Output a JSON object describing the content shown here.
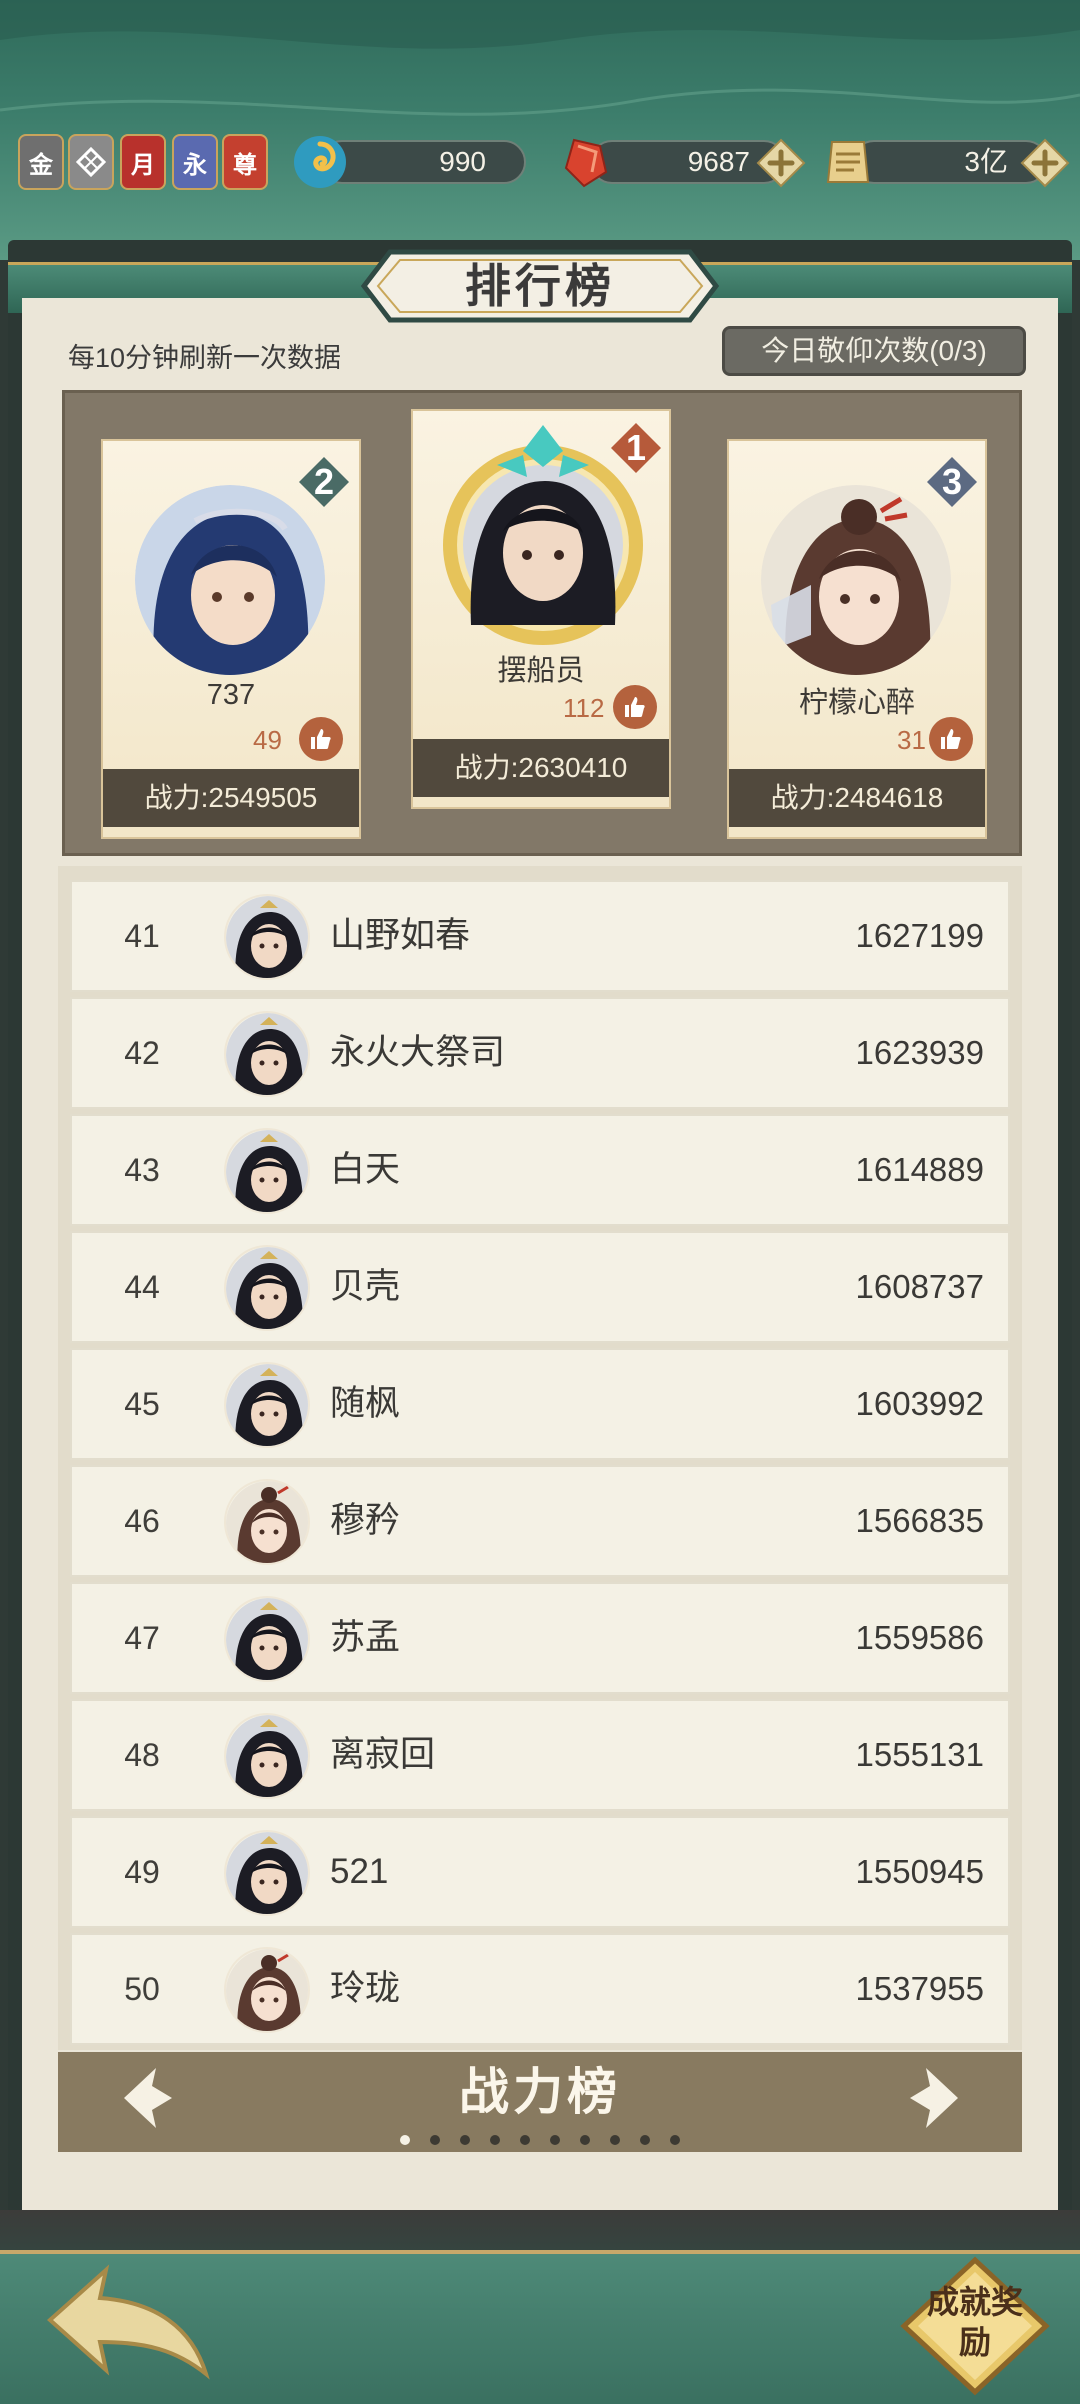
{
  "resources": {
    "badges": [
      {
        "label": "金",
        "color": "#6f6f6f",
        "icon": "gold-badge-icon"
      },
      {
        "label": "",
        "color": "#8a8a8a",
        "icon": "jade-knot-badge-icon"
      },
      {
        "label": "月",
        "color": "#b8312c",
        "icon": "month-card-badge-icon"
      },
      {
        "label": "永",
        "color": "#5a6ab0",
        "icon": "permanent-card-badge-icon"
      },
      {
        "label": "尊",
        "color": "#c4402f",
        "icon": "noble-badge-icon"
      }
    ],
    "stamina": {
      "value": "990",
      "icon": "swirl-energy-icon"
    },
    "gems": {
      "value": "9687",
      "icon": "red-crystal-icon"
    },
    "silver": {
      "value": "3亿",
      "icon": "scroll-ticket-icon"
    }
  },
  "panel": {
    "title": "排行榜",
    "refresh_note": "每10分钟刷新一次数据",
    "worship_button": "今日敬仰次数(0/3)"
  },
  "podium": [
    {
      "rank": "1",
      "name": "摆船员",
      "likes": "112",
      "power": "战力:2630410"
    },
    {
      "rank": "2",
      "name": "737",
      "likes": "49",
      "power": "战力:2549505"
    },
    {
      "rank": "3",
      "name": "柠檬心醉",
      "likes": "31",
      "power": "战力:2484618"
    }
  ],
  "list": [
    {
      "rank": "41",
      "name": "山野如春",
      "power": "1627199",
      "avatar": "male"
    },
    {
      "rank": "42",
      "name": "永火大祭司",
      "power": "1623939",
      "avatar": "male"
    },
    {
      "rank": "43",
      "name": "白天",
      "power": "1614889",
      "avatar": "male"
    },
    {
      "rank": "44",
      "name": "贝壳",
      "power": "1608737",
      "avatar": "male"
    },
    {
      "rank": "45",
      "name": "随枫",
      "power": "1603992",
      "avatar": "male"
    },
    {
      "rank": "46",
      "name": "穆矜",
      "power": "1566835",
      "avatar": "female"
    },
    {
      "rank": "47",
      "name": "苏孟",
      "power": "1559586",
      "avatar": "male"
    },
    {
      "rank": "48",
      "name": "离寂回",
      "power": "1555131",
      "avatar": "male"
    },
    {
      "rank": "49",
      "name": "521",
      "power": "1550945",
      "avatar": "male"
    },
    {
      "rank": "50",
      "name": "玲珑",
      "power": "1537955",
      "avatar": "female"
    }
  ],
  "board": {
    "title": "战力榜",
    "page_count": 10,
    "active_page": 0
  },
  "footer": {
    "achievement_button": "成就奖励"
  },
  "colors": {
    "accent_gold": "#c9a75a",
    "like_orange": "#b4623d",
    "teal": "#3d7e6c"
  }
}
